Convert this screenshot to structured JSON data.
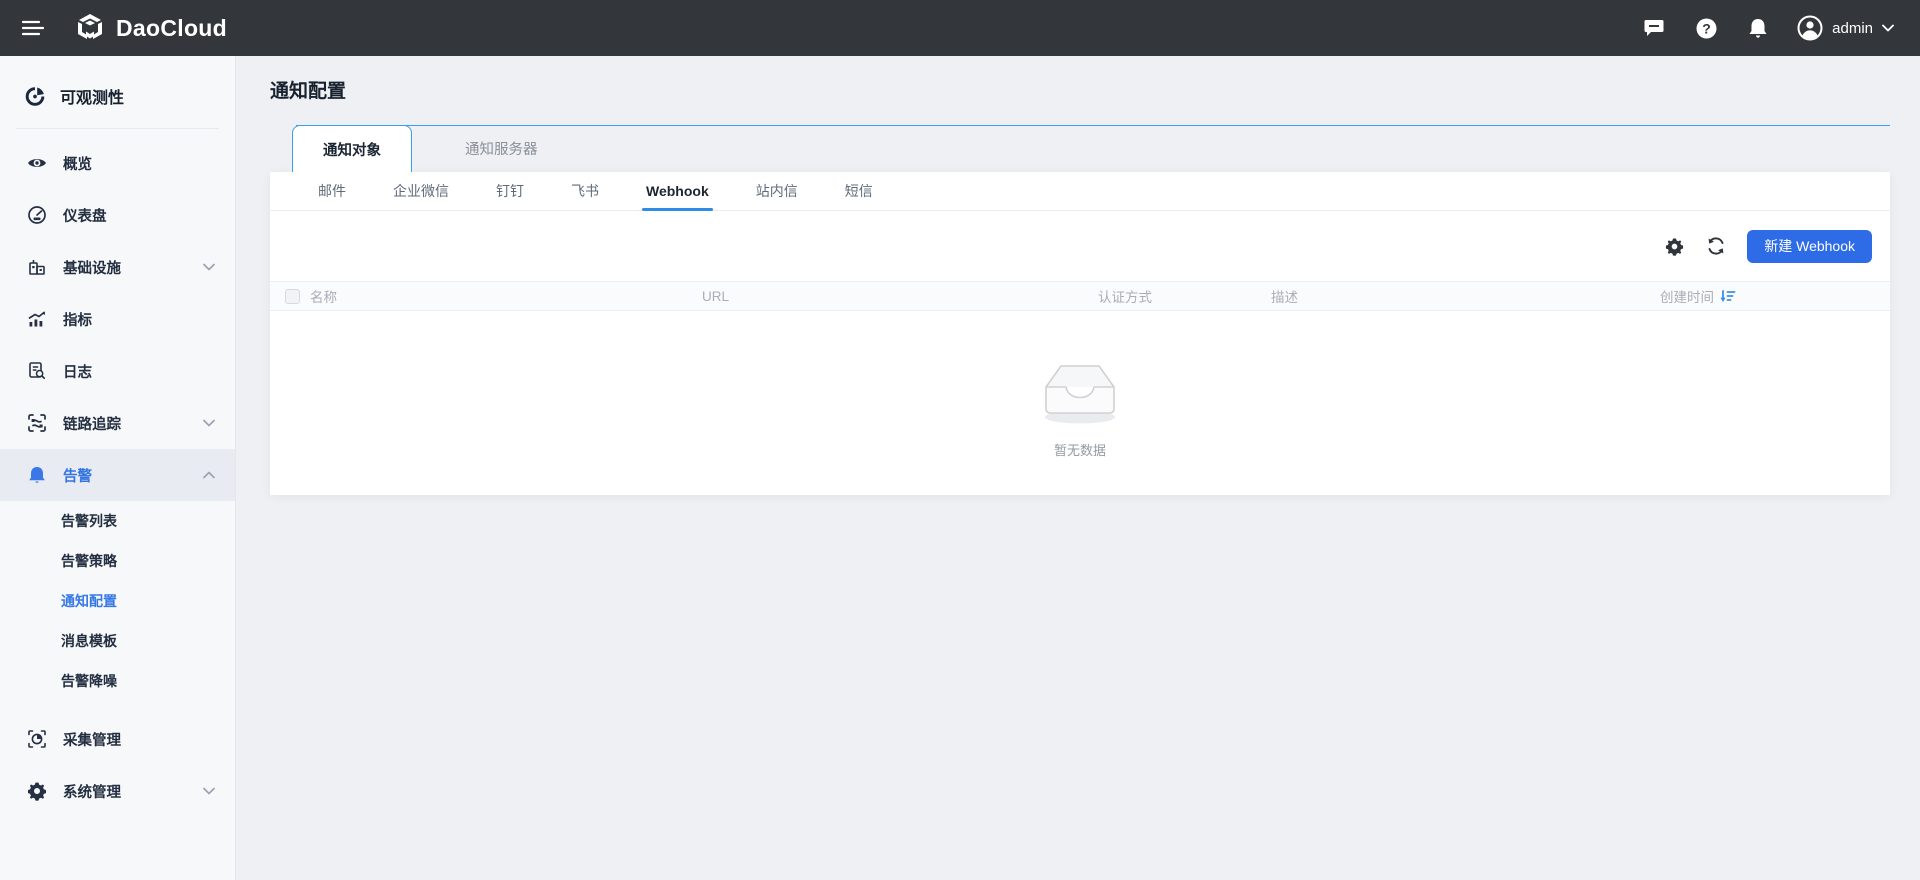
{
  "navbar": {
    "brand": "DaoCloud",
    "user": "admin"
  },
  "sidebar": {
    "title": "可观测性",
    "items": [
      {
        "label": "概览"
      },
      {
        "label": "仪表盘"
      },
      {
        "label": "基础设施"
      },
      {
        "label": "指标"
      },
      {
        "label": "日志"
      },
      {
        "label": "链路追踪"
      },
      {
        "label": "告警"
      },
      {
        "label": "采集管理"
      },
      {
        "label": "系统管理"
      }
    ],
    "alert_children": [
      {
        "label": "告警列表"
      },
      {
        "label": "告警策略"
      },
      {
        "label": "通知配置"
      },
      {
        "label": "消息模板"
      },
      {
        "label": "告警降噪"
      }
    ]
  },
  "page": {
    "title": "通知配置",
    "tabs": [
      {
        "label": "通知对象"
      },
      {
        "label": "通知服务器"
      }
    ],
    "channel_tabs": [
      "邮件",
      "企业微信",
      "钉钉",
      "飞书",
      "Webhook",
      "站内信",
      "短信"
    ],
    "active_channel": "Webhook",
    "toolbar": {
      "create_label": "新建 Webhook"
    },
    "table": {
      "columns": [
        "名称",
        "URL",
        "认证方式",
        "描述",
        "创建时间"
      ]
    },
    "empty": {
      "text": "暂无数据"
    }
  },
  "colors": {
    "navbar_bg": "#33373c",
    "accent_blue": "#2e6be6",
    "tab_border_blue": "#3f9fe6",
    "underline_blue": "#2f8ce4",
    "sidebar_active_bg": "#e8ebf2",
    "sidebar_active_text": "#3374e2"
  }
}
